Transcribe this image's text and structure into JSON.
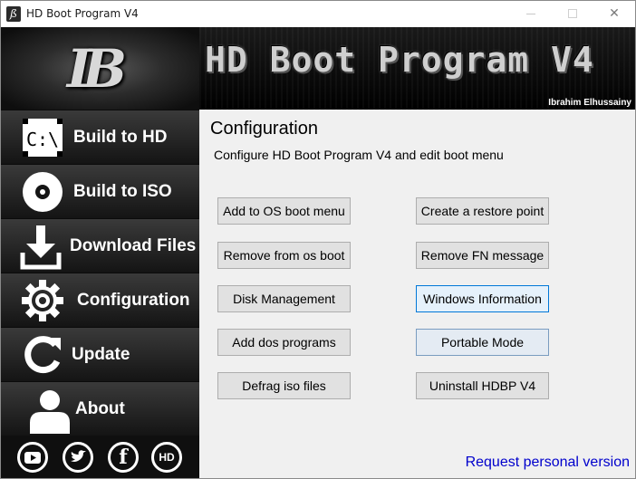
{
  "window": {
    "title": "HD Boot Program V4",
    "app_icon_glyph": "ß",
    "controls": {
      "minimize": "minimize-icon",
      "maximize": "maximize-icon",
      "close_glyph": "✕"
    }
  },
  "sidebar": {
    "logo_text": "IB",
    "items": [
      {
        "label": "Build to HD",
        "icon": "drive-icon",
        "icon_text": "C:\\"
      },
      {
        "label": "Build to ISO",
        "icon": "disc-icon"
      },
      {
        "label": "Download Files",
        "icon": "download-icon"
      },
      {
        "label": "Configuration",
        "icon": "gear-icon"
      },
      {
        "label": "Update",
        "icon": "refresh-icon"
      },
      {
        "label": "About",
        "icon": "user-icon"
      }
    ],
    "social": [
      {
        "icon": "youtube-icon",
        "glyph": "▶"
      },
      {
        "icon": "twitter-icon",
        "glyph": "🐦"
      },
      {
        "icon": "facebook-icon",
        "glyph": "f"
      },
      {
        "icon": "hd-logo-icon",
        "glyph": "HD"
      }
    ]
  },
  "banner": {
    "title": "HD Boot Program V4",
    "author": "Ibrahim Elhussainy"
  },
  "content": {
    "title": "Configuration",
    "subtitle": "Configure HD Boot Program V4 and edit boot menu",
    "buttons_left": [
      "Add to OS boot menu",
      "Remove from os boot",
      "Disk Management",
      "Add dos programs",
      "Defrag iso files"
    ],
    "buttons_right": [
      "Create a restore point",
      "Remove FN message",
      "Windows Information",
      "Portable Mode",
      "Uninstall HDBP V4"
    ],
    "request_link": "Request personal version"
  },
  "colors": {
    "sidebar_bg": "#151515",
    "link": "#0000cc",
    "button_bg": "#e1e1e1",
    "button_focus_border": "#0078d7"
  }
}
